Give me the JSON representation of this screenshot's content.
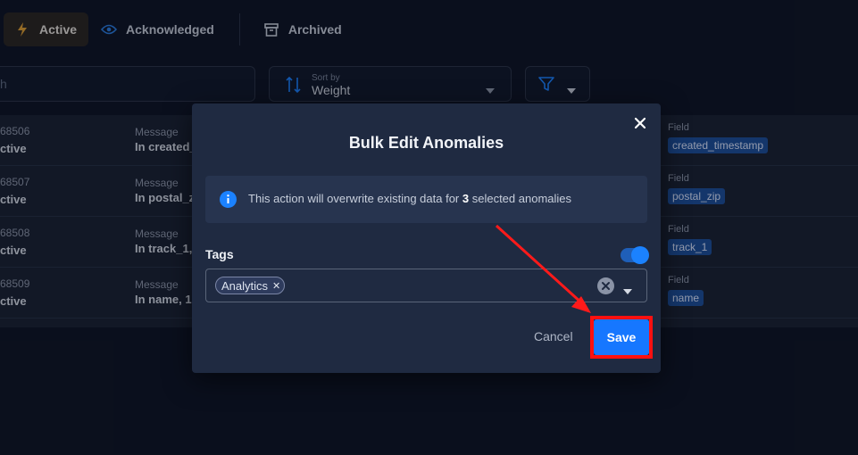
{
  "tabs": [
    {
      "label": "Active",
      "icon": "bolt-icon"
    },
    {
      "label": "Acknowledged",
      "icon": "eye-icon"
    },
    {
      "label": "Archived",
      "icon": "archive-icon"
    }
  ],
  "search": {
    "placeholder_fragment": "h"
  },
  "sort": {
    "caption": "Sort by",
    "value": "Weight"
  },
  "rows": [
    {
      "id": "68506",
      "status": "ctive",
      "message_label": "Message",
      "message": "In created_",
      "field_label": "Field",
      "field": "created_timestamp"
    },
    {
      "id": "68507",
      "status": "ctive",
      "message_label": "Message",
      "message": "In postal_z",
      "field_label": "Field",
      "field": "postal_zip"
    },
    {
      "id": "68508",
      "status": "ctive",
      "message_label": "Message",
      "message": "In track_1,",
      "field_label": "Field",
      "field": "track_1"
    },
    {
      "id": "68509",
      "status": "ctive",
      "message_label": "Message",
      "message": "In name, 1.3",
      "field_label": "Field",
      "field": "name"
    }
  ],
  "modal": {
    "title": "Bulk Edit Anomalies",
    "info_prefix": "This action will overwrite existing data for ",
    "info_count": "3",
    "info_suffix": " selected anomalies",
    "tags_label": "Tags",
    "tag_chip": "Analytics",
    "cancel_label": "Cancel",
    "save_label": "Save"
  },
  "colors": {
    "accent": "#1677ff",
    "highlight": "#ff1010",
    "background": "#0d1322",
    "modal": "#1f2a41"
  }
}
